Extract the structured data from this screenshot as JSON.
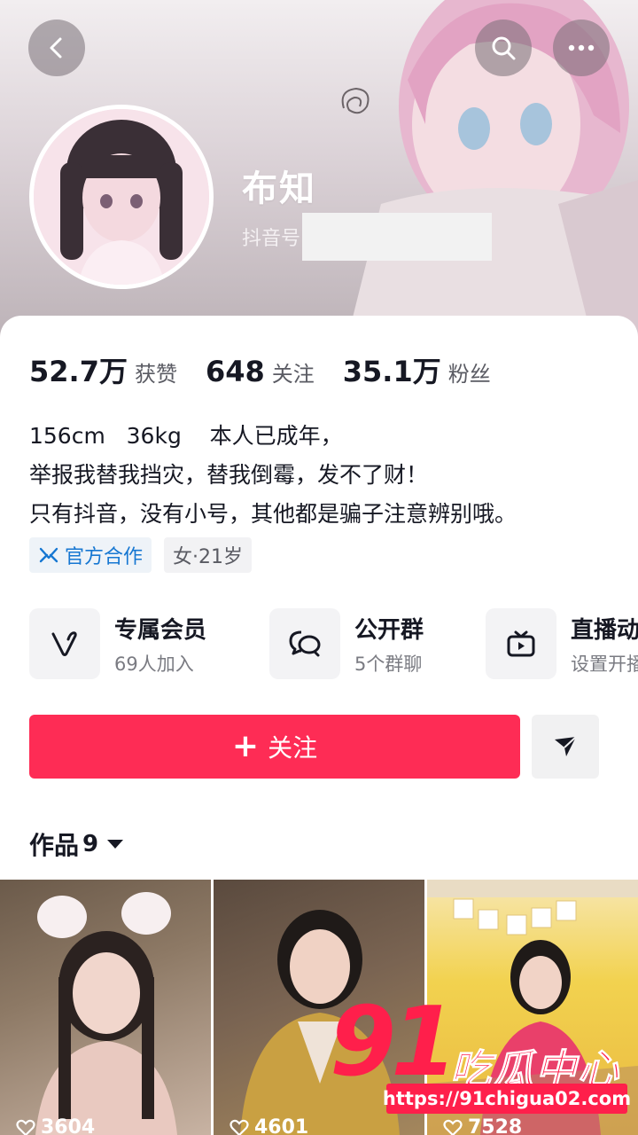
{
  "profile": {
    "name": "布知",
    "douyin_id_label": "抖音号"
  },
  "stats": [
    {
      "value": "52.7万",
      "label": "获赞"
    },
    {
      "value": "648",
      "label": "关注"
    },
    {
      "value": "35.1万",
      "label": "粉丝"
    }
  ],
  "bio": [
    "156cm   36kg    本人已成年，",
    "举报我替我挡灾，替我倒霉，发不了财！",
    "只有抖音，没有小号，其他都是骗子注意辨别哦。"
  ],
  "tags": {
    "official": "官方合作",
    "gender_age": "女·21岁"
  },
  "features": [
    {
      "title": "专属会员",
      "subtitle": "69人加入",
      "icon": "v-heart-icon"
    },
    {
      "title": "公开群",
      "subtitle": "5个群聊",
      "icon": "chat-bubbles-icon"
    },
    {
      "title": "直播动态",
      "subtitle": "设置开播提醒",
      "icon": "tv-icon"
    }
  ],
  "actions": {
    "follow_label": "关注",
    "follow_plus": "+"
  },
  "works": {
    "label": "作品",
    "count": "9"
  },
  "videos": [
    {
      "likes": "3604"
    },
    {
      "likes": "4601"
    },
    {
      "likes": "7528"
    }
  ],
  "watermark": {
    "number": "91",
    "text": "吃瓜中心",
    "url": "https://91chigua02.com"
  },
  "colors": {
    "accent": "#fe2c55",
    "official_blue": "#1677d2",
    "watermark": "#ff1f4b"
  }
}
